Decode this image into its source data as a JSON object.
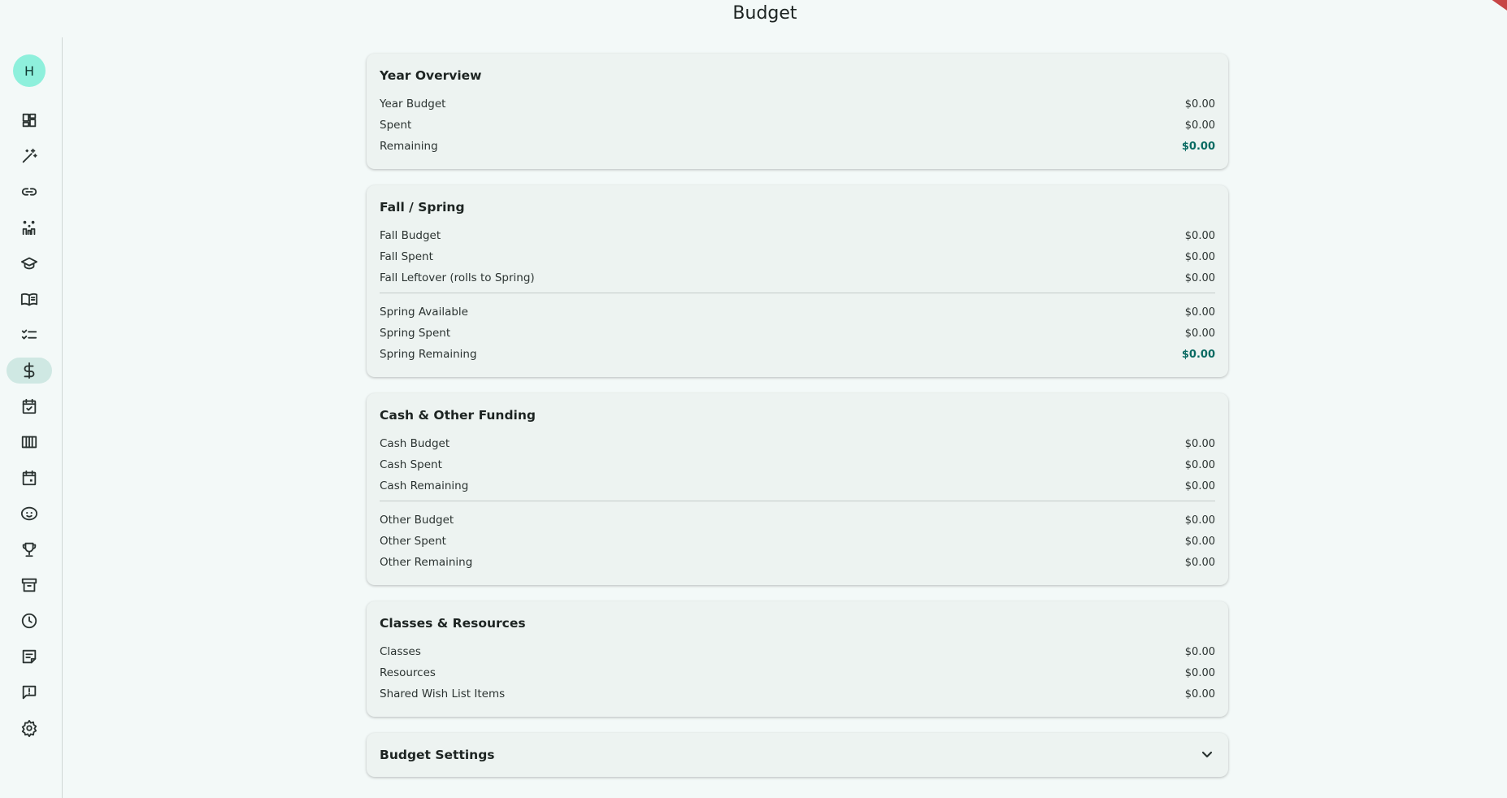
{
  "header": {
    "title": "Budget"
  },
  "user": {
    "avatar_initial": "H"
  },
  "sidebar": {
    "items": [
      {
        "name": "dashboard-icon",
        "active": false
      },
      {
        "name": "magic-wand-icon",
        "active": false
      },
      {
        "name": "link-icon",
        "active": false
      },
      {
        "name": "family-icon",
        "active": false
      },
      {
        "name": "graduation-cap-icon",
        "active": false
      },
      {
        "name": "book-icon",
        "active": false
      },
      {
        "name": "checklist-icon",
        "active": false
      },
      {
        "name": "dollar-icon",
        "active": true
      },
      {
        "name": "calendar-check-icon",
        "active": false
      },
      {
        "name": "columns-icon",
        "active": false
      },
      {
        "name": "calendar-icon",
        "active": false
      },
      {
        "name": "face-icon",
        "active": false
      },
      {
        "name": "trophy-icon",
        "active": false
      },
      {
        "name": "archive-icon",
        "active": false
      },
      {
        "name": "clock-icon",
        "active": false
      },
      {
        "name": "notes-icon",
        "active": false
      },
      {
        "name": "feedback-icon",
        "active": false
      },
      {
        "name": "settings-icon",
        "active": false
      }
    ]
  },
  "cards": {
    "year_overview": {
      "title": "Year Overview",
      "rows": [
        {
          "label": "Year Budget",
          "value": "$0.00"
        },
        {
          "label": "Spent",
          "value": "$0.00"
        },
        {
          "label": "Remaining",
          "value": "$0.00"
        }
      ]
    },
    "fall_spring": {
      "title": "Fall / Spring",
      "rows": [
        {
          "label": "Fall Budget",
          "value": "$0.00"
        },
        {
          "label": "Fall Spent",
          "value": "$0.00"
        },
        {
          "label": "Fall Leftover (rolls to Spring)",
          "value": "$0.00"
        },
        {
          "label": "Spring Available",
          "value": "$0.00"
        },
        {
          "label": "Spring Spent",
          "value": "$0.00"
        },
        {
          "label": "Spring Remaining",
          "value": "$0.00"
        }
      ]
    },
    "cash_other": {
      "title": "Cash & Other Funding",
      "rows": [
        {
          "label": "Cash Budget",
          "value": "$0.00"
        },
        {
          "label": "Cash Spent",
          "value": "$0.00"
        },
        {
          "label": "Cash Remaining",
          "value": "$0.00"
        },
        {
          "label": "Other Budget",
          "value": "$0.00"
        },
        {
          "label": "Other Spent",
          "value": "$0.00"
        },
        {
          "label": "Other Remaining",
          "value": "$0.00"
        }
      ]
    },
    "classes_resources": {
      "title": "Classes & Resources",
      "rows": [
        {
          "label": "Classes",
          "value": "$0.00"
        },
        {
          "label": "Resources",
          "value": "$0.00"
        },
        {
          "label": "Shared Wish List Items",
          "value": "$0.00"
        }
      ]
    },
    "budget_settings": {
      "title": "Budget Settings",
      "expanded": false
    }
  },
  "colors": {
    "accent": "#0a6b63",
    "active_nav": "#cfe8e3",
    "avatar": "#8ef0dc"
  }
}
